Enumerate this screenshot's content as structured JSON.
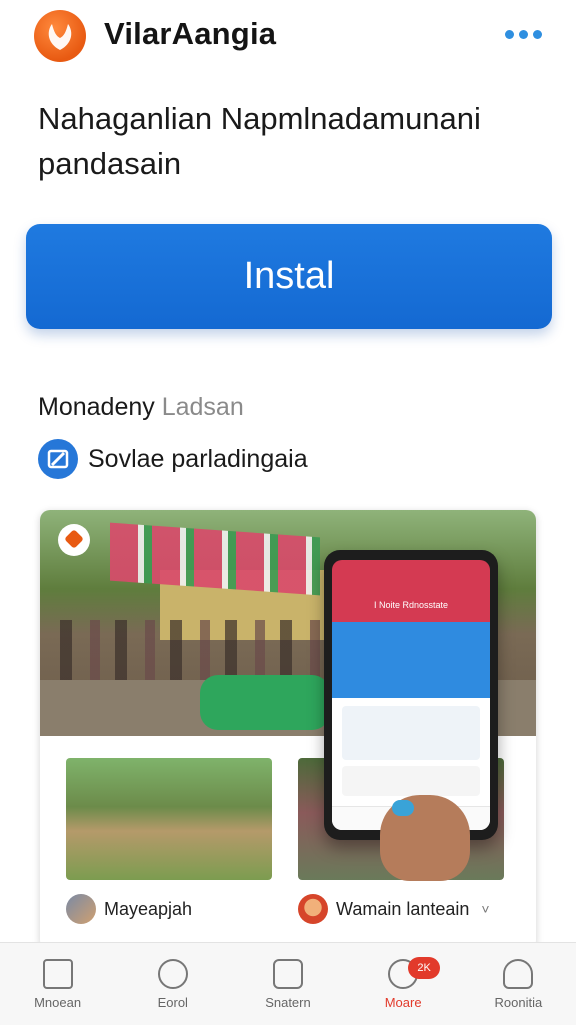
{
  "header": {
    "app_name": "VilarAangia",
    "menu_icon": "more-dots-icon",
    "accent": "#2f8fe0"
  },
  "headline": "Nahaganlian Napmlnadamunani pandasain",
  "install": {
    "label": "Instal",
    "color": "#1f7ae0"
  },
  "section": {
    "title_main": "Monadeny",
    "title_muted": "Ladsan",
    "feature_label": "Sovlae parladingaia",
    "feature_icon": "edit-icon"
  },
  "media": {
    "captions": [
      {
        "text": "Mayeapjah",
        "icon": "avatar"
      },
      {
        "text": "Wamain lanteain",
        "icon": "avatar",
        "chevron": "˅"
      }
    ],
    "phone_screen_title": "I Noite Rdnosstate"
  },
  "bottom_nav": {
    "items": [
      {
        "label": "Mnoean",
        "icon": "home-icon"
      },
      {
        "label": "Eorol",
        "icon": "compass-icon"
      },
      {
        "label": "Snatern",
        "icon": "grid-icon"
      },
      {
        "label": "Moare",
        "icon": "chat-icon",
        "badge": "2K",
        "active": true
      },
      {
        "label": "Roonitia",
        "icon": "profile-icon"
      }
    ],
    "active_color": "#e23a2b"
  }
}
